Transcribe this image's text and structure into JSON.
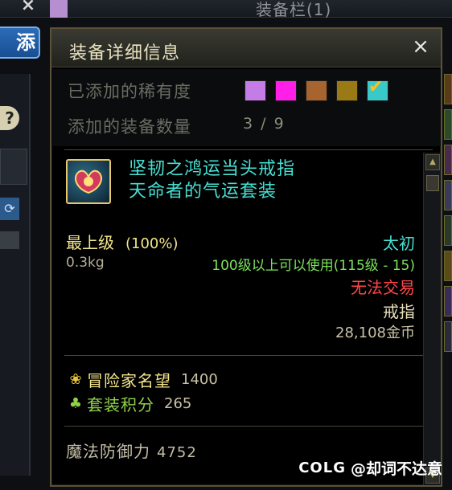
{
  "background": {
    "title": "装备栏(1)",
    "add_button": "添加",
    "help_glyph": "?",
    "refresh_glyph": "⟳",
    "close_glyph": "×"
  },
  "tooltip": {
    "title": "装备详细信息",
    "close_glyph": "×",
    "rarity_label": "已添加的稀有度",
    "rarity_colors": [
      "#c47de6",
      "#ff1fe8",
      "#a8642e",
      "#9a7a14",
      "#3ac9c9"
    ],
    "count_label": "添加的装备数量",
    "count_value": "3 / 9",
    "item": {
      "name": "坚韧之鸿运当头戒指",
      "set": "天命者的气运套装",
      "grade": "最上级",
      "grade_pct": "(100%)",
      "tier": "太初",
      "weight": "0.3kg",
      "level_req": "100级以上可以使用(115级 - 15)",
      "trade": "无法交易",
      "slot": "戒指",
      "price": "28,108金币"
    },
    "stats": {
      "fame_label": "冒险家名望",
      "fame_value": "1400",
      "set_points_label": "套装积分",
      "set_points_value": "265",
      "mdef_label": "魔法防御力",
      "mdef_value": "4752"
    }
  },
  "credit": {
    "logo": "COLG",
    "text": "@却词不达意"
  }
}
